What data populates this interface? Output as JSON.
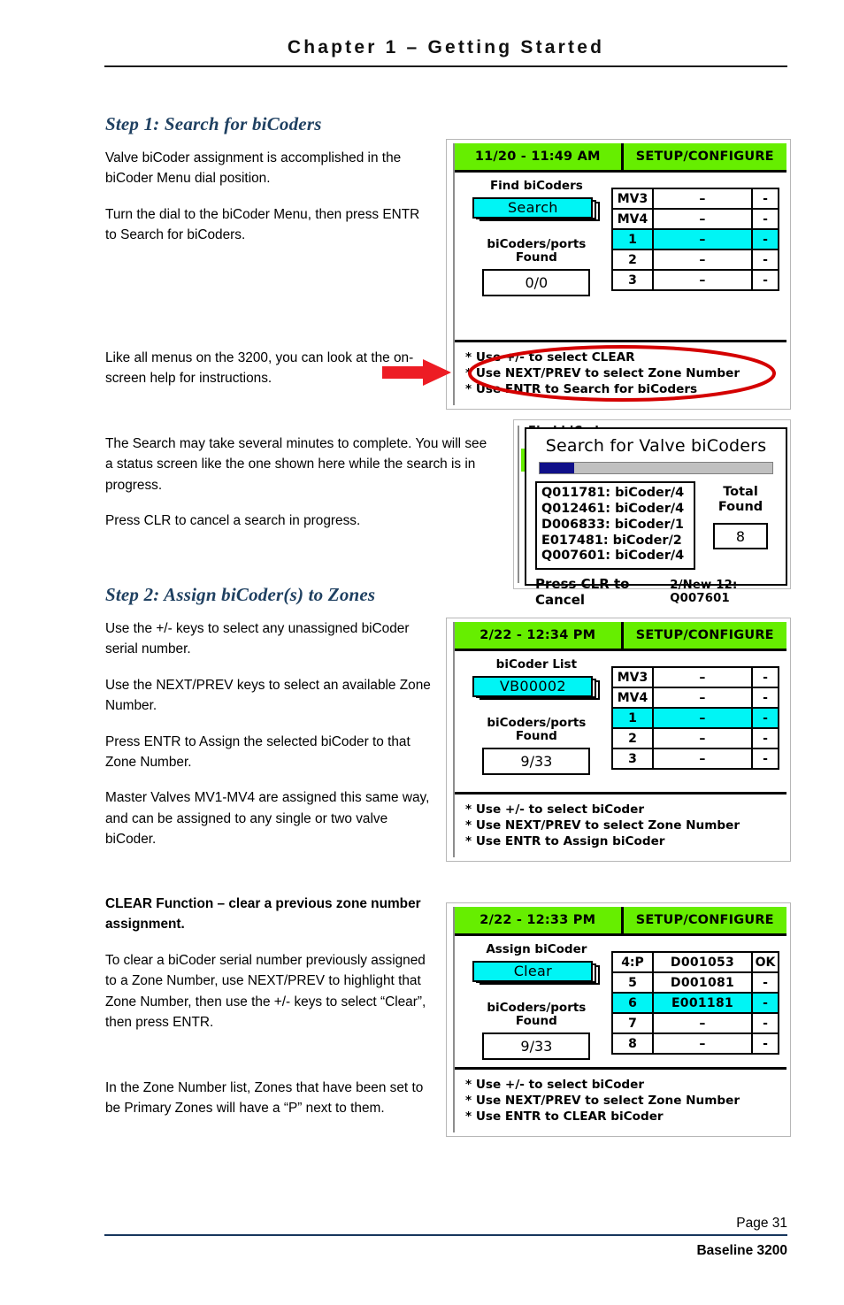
{
  "header": {
    "chapter_title": "Chapter 1 – Getting Started"
  },
  "footer": {
    "page_label": "Page 31",
    "product": "Baseline 3200"
  },
  "sections": {
    "step1": {
      "heading": "Step 1: Search for biCoders",
      "p1": "Valve biCoder assignment is accomplished in the biCoder Menu dial position.",
      "p2": "Turn the dial to the biCoder Menu, then press ENTR to Search for biCoders.",
      "p3": "Like all menus on the 3200, you can look at the on-screen help for instructions.",
      "p4": "The Search may take several minutes to complete.  You will see a status screen like the one shown here while the search is in progress.",
      "p5": "Press CLR to cancel a search in progress."
    },
    "step2": {
      "heading": "Step 2: Assign biCoder(s) to Zones",
      "p1": "Use the +/- keys to select any unassigned biCoder serial number.",
      "p2": "Use the NEXT/PREV keys to select an available Zone Number.",
      "p3": "Press ENTR to Assign the selected biCoder to that Zone Number.",
      "p4": "Master Valves MV1-MV4 are assigned this same way, and can be assigned to any single or two valve biCoder."
    },
    "clear": {
      "heading": "CLEAR Function – clear a previous zone number assignment.",
      "p1": "To clear a biCoder serial number previously assigned to a Zone Number, use NEXT/PREV to highlight that Zone Number, then use the +/- keys to select “Clear”, then press ENTR.",
      "p2": "In the Zone Number list, Zones that have been set to be Primary Zones will have a “P” next to them."
    }
  },
  "colors": {
    "lcd_titlebar_green": "#66EE00",
    "lcd_highlight_cyan": "#00F5F5",
    "annotation_red": "#D40000",
    "heading_blue": "#1F4061",
    "progress_fill_navy": "#101089",
    "progress_track_gray": "#C0C0C0",
    "footer_rule_blue": "#17365D"
  },
  "screens": {
    "find_bicoders": {
      "titlebar": {
        "datetime": "11/20 - 11:49 AM",
        "mode": "SETUP/CONFIGURE"
      },
      "left_caption": "Find biCoders",
      "selector_value": "Search",
      "found_caption_line1": "biCoders/ports",
      "found_caption_line2": "Found",
      "found_value": "0/0",
      "table": [
        {
          "zone": "MV3",
          "serial": "–",
          "status": "-",
          "selected": false
        },
        {
          "zone": "MV4",
          "serial": "–",
          "status": "-",
          "selected": false
        },
        {
          "zone": "1",
          "serial": "–",
          "status": "-",
          "selected": true
        },
        {
          "zone": "2",
          "serial": "–",
          "status": "-",
          "selected": false
        },
        {
          "zone": "3",
          "serial": "–",
          "status": "-",
          "selected": false
        }
      ],
      "help": [
        "* Use +/- to select CLEAR",
        "* Use NEXT/PREV to select Zone Number",
        "* Use ENTR to Search for biCoders"
      ]
    },
    "search_progress": {
      "ghost_text": "Find biCoders",
      "title": "Search for Valve biCoders",
      "progress_percent": 15,
      "found_list": [
        "Q011781: biCoder/4",
        "Q012461: biCoder/4",
        "D006833: biCoder/1",
        "E017481: biCoder/2",
        "Q007601: biCoder/4"
      ],
      "total_label_line1": "Total",
      "total_label_line2": "Found",
      "total_value": "8",
      "cancel_text": "Press CLR to Cancel",
      "status_text": "2/New 12: Q007601"
    },
    "bicoder_list": {
      "titlebar": {
        "datetime": "2/22 - 12:34 PM",
        "mode": "SETUP/CONFIGURE"
      },
      "left_caption": "biCoder List",
      "selector_value": "VB00002",
      "found_caption_line1": "biCoders/ports",
      "found_caption_line2": "Found",
      "found_value": "9/33",
      "table": [
        {
          "zone": "MV3",
          "serial": "–",
          "status": "-",
          "selected": false
        },
        {
          "zone": "MV4",
          "serial": "–",
          "status": "-",
          "selected": false
        },
        {
          "zone": "1",
          "serial": "–",
          "status": "-",
          "selected": true
        },
        {
          "zone": "2",
          "serial": "–",
          "status": "-",
          "selected": false
        },
        {
          "zone": "3",
          "serial": "–",
          "status": "-",
          "selected": false
        }
      ],
      "help": [
        "* Use +/- to select biCoder",
        "* Use NEXT/PREV to select Zone Number",
        "* Use ENTR to Assign biCoder"
      ]
    },
    "assign_bicoder": {
      "titlebar": {
        "datetime": "2/22 - 12:33 PM",
        "mode": "SETUP/CONFIGURE"
      },
      "left_caption": "Assign biCoder",
      "selector_value": "Clear",
      "found_caption_line1": "biCoders/ports",
      "found_caption_line2": "Found",
      "found_value": "9/33",
      "table": [
        {
          "zone": "4:P",
          "serial": "D001053",
          "status": "OK",
          "selected": false
        },
        {
          "zone": "5",
          "serial": "D001081",
          "status": "-",
          "selected": false
        },
        {
          "zone": "6",
          "serial": "E001181",
          "status": "-",
          "selected": true
        },
        {
          "zone": "7",
          "serial": "–",
          "status": "-",
          "selected": false
        },
        {
          "zone": "8",
          "serial": "–",
          "status": "-",
          "selected": false
        }
      ],
      "help": [
        "* Use +/- to select biCoder",
        "* Use NEXT/PREV to select Zone Number",
        "* Use ENTR to CLEAR biCoder"
      ]
    }
  }
}
